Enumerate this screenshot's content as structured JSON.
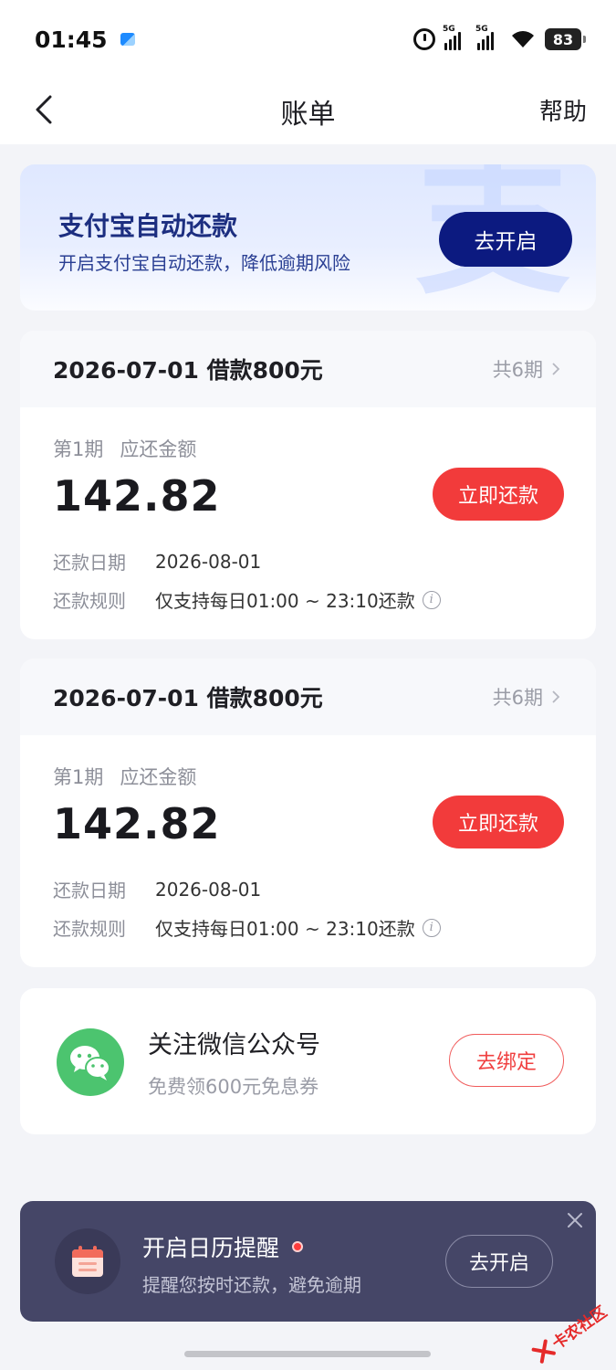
{
  "status_bar": {
    "time": "01:45",
    "net1": "5G",
    "net2": "5G",
    "battery": "83"
  },
  "header": {
    "title": "账单",
    "help": "帮助"
  },
  "alipay_banner": {
    "title": "支付宝自动还款",
    "subtitle": "开启支付宝自动还款，降低逾期风险",
    "button": "去开启",
    "watermark": "支"
  },
  "bills": [
    {
      "title": "2026-07-01 借款800元",
      "periods": "共6期",
      "period": "第1期",
      "amount_label": "应还金额",
      "amount": "142.82",
      "button": "立即还款",
      "date_key": "还款日期",
      "date_val": "2026-08-01",
      "rule_key": "还款规则",
      "rule_val": "仅支持每日01:00 ~ 23:10还款"
    },
    {
      "title": "2026-07-01 借款800元",
      "periods": "共6期",
      "period": "第1期",
      "amount_label": "应还金额",
      "amount": "142.82",
      "button": "立即还款",
      "date_key": "还款日期",
      "date_val": "2026-08-01",
      "rule_key": "还款规则",
      "rule_val": "仅支持每日01:00 ~ 23:10还款"
    }
  ],
  "wechat": {
    "title": "关注微信公众号",
    "subtitle": "免费领600元免息券",
    "button": "去绑定"
  },
  "reminder": {
    "title": "开启日历提醒",
    "subtitle": "提醒您按时还款，避免逾期",
    "button": "去开启"
  },
  "watermark": {
    "text": "卡农社区"
  },
  "colors": {
    "primary_red": "#f23b3b",
    "alipay_navy": "#0c1a80",
    "wechat_green": "#4cc46f",
    "reminder_bg": "#454667",
    "page_bg": "#f3f4f8"
  }
}
